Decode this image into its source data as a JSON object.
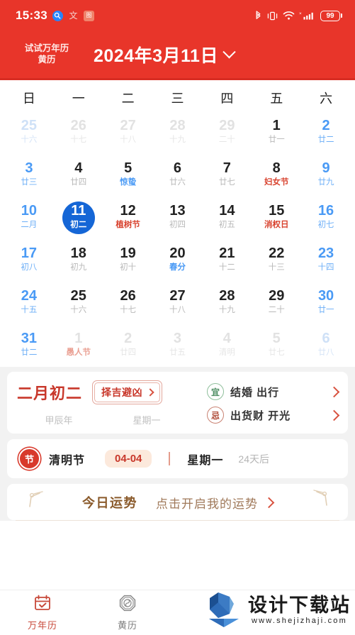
{
  "statusbar": {
    "time": "15:33",
    "icons_left": [
      "search-icon",
      "app-icon-text",
      "app-icon-orange"
    ],
    "icons_right": [
      "bluetooth-icon",
      "vibrate-icon",
      "wifi-icon",
      "cellular-signal-icon"
    ],
    "battery_level": "99"
  },
  "header": {
    "promo_line1": "试试万年历",
    "promo_line2": "黄历",
    "title": "2024年3月11日",
    "dropdown_icon": "chevron-down-icon",
    "background": "#E8352A"
  },
  "calendar": {
    "weekdays": [
      "日",
      "一",
      "二",
      "三",
      "四",
      "五",
      "六"
    ],
    "selected_day": "11",
    "selected_color": "#1566D6",
    "weeks": [
      [
        {
          "num": "25",
          "lunar": "十六",
          "out": true,
          "weekend": true
        },
        {
          "num": "26",
          "lunar": "十七",
          "out": true
        },
        {
          "num": "27",
          "lunar": "十八",
          "out": true
        },
        {
          "num": "28",
          "lunar": "十九",
          "out": true
        },
        {
          "num": "29",
          "lunar": "二十",
          "out": true
        },
        {
          "num": "1",
          "lunar": "廿一"
        },
        {
          "num": "2",
          "lunar": "廿二",
          "weekend": true
        }
      ],
      [
        {
          "num": "3",
          "lunar": "廿三",
          "weekend": true
        },
        {
          "num": "4",
          "lunar": "廿四"
        },
        {
          "num": "5",
          "lunar": "惊蛰",
          "term": true
        },
        {
          "num": "6",
          "lunar": "廿六"
        },
        {
          "num": "7",
          "lunar": "廿七"
        },
        {
          "num": "8",
          "lunar": "妇女节",
          "festival": true
        },
        {
          "num": "9",
          "lunar": "廿九",
          "weekend": true
        }
      ],
      [
        {
          "num": "10",
          "lunar": "二月",
          "weekend": true
        },
        {
          "num": "11",
          "lunar": "初二",
          "selected": true
        },
        {
          "num": "12",
          "lunar": "植树节",
          "festival": true
        },
        {
          "num": "13",
          "lunar": "初四"
        },
        {
          "num": "14",
          "lunar": "初五"
        },
        {
          "num": "15",
          "lunar": "消权日",
          "festival": true
        },
        {
          "num": "16",
          "lunar": "初七",
          "weekend": true
        }
      ],
      [
        {
          "num": "17",
          "lunar": "初八",
          "weekend": true
        },
        {
          "num": "18",
          "lunar": "初九"
        },
        {
          "num": "19",
          "lunar": "初十"
        },
        {
          "num": "20",
          "lunar": "春分",
          "term": true
        },
        {
          "num": "21",
          "lunar": "十二"
        },
        {
          "num": "22",
          "lunar": "十三"
        },
        {
          "num": "23",
          "lunar": "十四",
          "weekend": true
        }
      ],
      [
        {
          "num": "24",
          "lunar": "十五",
          "weekend": true
        },
        {
          "num": "25",
          "lunar": "十六"
        },
        {
          "num": "26",
          "lunar": "十七"
        },
        {
          "num": "27",
          "lunar": "十八"
        },
        {
          "num": "28",
          "lunar": "十九"
        },
        {
          "num": "29",
          "lunar": "二十"
        },
        {
          "num": "30",
          "lunar": "廿一",
          "weekend": true
        }
      ],
      [
        {
          "num": "31",
          "lunar": "廿二",
          "weekend": true
        },
        {
          "num": "1",
          "lunar": "愚人节",
          "out": true,
          "festival": true
        },
        {
          "num": "2",
          "lunar": "廿四",
          "out": true
        },
        {
          "num": "3",
          "lunar": "廿五",
          "out": true
        },
        {
          "num": "4",
          "lunar": "清明",
          "out": true
        },
        {
          "num": "5",
          "lunar": "廿七",
          "out": true
        },
        {
          "num": "6",
          "lunar": "廿八",
          "out": true,
          "weekend": true
        }
      ]
    ]
  },
  "lunar_info": {
    "lunar_date": "二月初二",
    "pick_button": "择吉避凶",
    "ganzhi_year": "甲辰年",
    "weekday": "星期一",
    "yi_label": "宜",
    "yi_items": "结婚 出行",
    "ji_label": "忌",
    "ji_items": "出货财 开光",
    "accent_red": "#C8372A",
    "yi_green": "#4E8E63"
  },
  "festival": {
    "badge": "节",
    "name": "清明节",
    "date": "04-04",
    "weekday": "星期一",
    "countdown": "24天后"
  },
  "fortune": {
    "title": "今日运势",
    "cta": "点击开启我的运势",
    "arrow_icon": "chevron-right-icon",
    "title_color": "#8A5A2B"
  },
  "bottom_nav": [
    {
      "label": "万年历",
      "icon": "calendar-check-icon",
      "active": true
    },
    {
      "label": "黄历",
      "icon": "bagua-icon",
      "active": false
    }
  ],
  "watermark": {
    "brand": "设计下载站",
    "url": "www.shejizhaji.com",
    "logo_icon": "download-arrow-logo"
  }
}
